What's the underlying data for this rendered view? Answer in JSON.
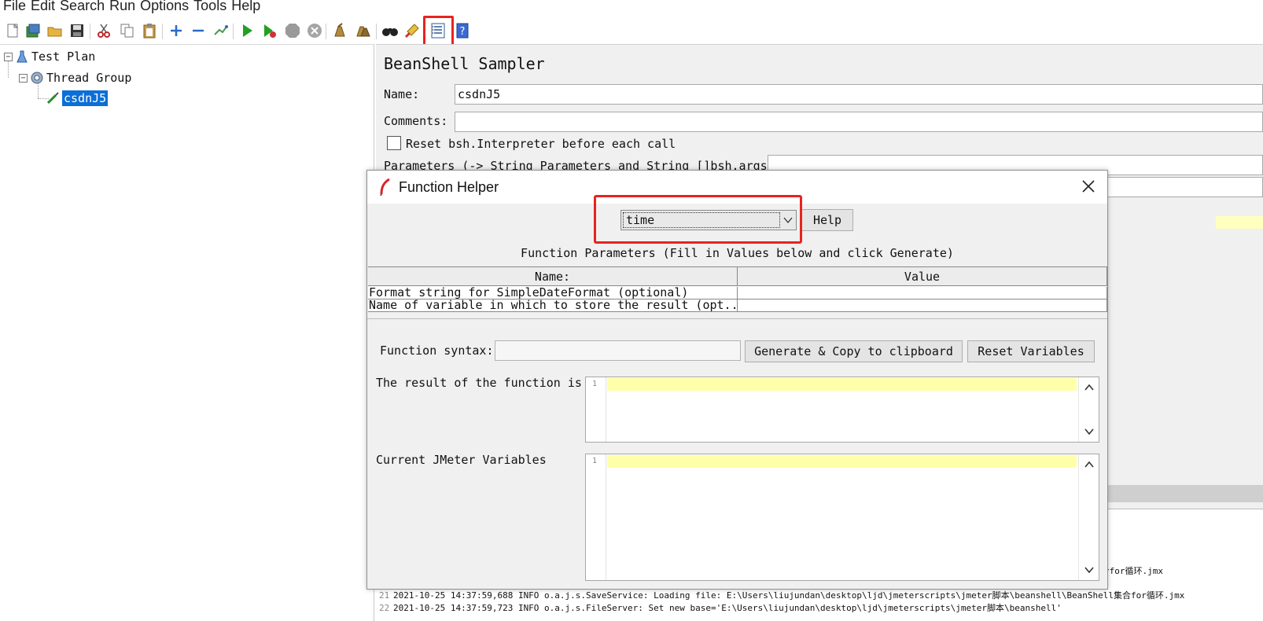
{
  "menu": [
    "File",
    "Edit",
    "Search",
    "Run",
    "Options",
    "Tools",
    "Help"
  ],
  "toolbar": {
    "icons": [
      "new-icon",
      "templates-icon",
      "open-icon",
      "save-icon",
      "cut-icon",
      "copy-icon",
      "paste-icon",
      "expand-icon",
      "collapse-icon",
      "toggle-icon",
      "start-icon",
      "start-no-pauses-icon",
      "stop-icon",
      "shutdown-icon",
      "clear-icon",
      "clear-all-icon",
      "search-icon",
      "reset-search-icon",
      "function-helper-icon",
      "help-icon"
    ],
    "highlight_color": "#e8231e"
  },
  "tree": {
    "items": [
      {
        "label": "Test Plan",
        "icon": "test-plan-icon"
      },
      {
        "label": "Thread Group",
        "icon": "thread-group-icon"
      },
      {
        "label": "csdnJ5",
        "icon": "sampler-icon",
        "selected": true
      }
    ],
    "selected_color": "#0b6fd6"
  },
  "sampler": {
    "title": "BeanShell Sampler",
    "name_label": "Name:",
    "name_value": "csdnJ5",
    "comments_label": "Comments:",
    "comments_value": "",
    "reset_label": "Reset bsh.Interpreter before each call",
    "params_label": "Parameters (-> String Parameters and String []bsh.args)"
  },
  "log": {
    "lines": [
      {
        "num": "",
        "text": "l集合for循环.jmx"
      },
      {
        "num": "21",
        "text": "2021-10-25 14:37:59,688 INFO o.a.j.s.SaveService: Loading file: E:\\Users\\liujundan\\desktop\\ljd\\jmeterscripts\\jmeter脚本\\beanshell\\BeanShell集合for循环.jmx"
      },
      {
        "num": "22",
        "text": "2021-10-25 14:37:59,723 INFO o.a.j.s.FileServer: Set new base='E:\\Users\\liujundan\\desktop\\ljd\\jmeterscripts\\jmeter脚本\\beanshell'"
      }
    ]
  },
  "dialog": {
    "title": "Function Helper",
    "selected_function": "time",
    "help_label": "Help",
    "params_caption": "Function Parameters (Fill in Values below and click Generate)",
    "columns": [
      "Name:",
      "Value"
    ],
    "rows": [
      {
        "name": "Format string for SimpleDateFormat (optional)",
        "value": ""
      },
      {
        "name": "Name of variable in which to store the result (opt...",
        "value": ""
      }
    ],
    "syntax_label": "Function syntax:",
    "syntax_value": "",
    "generate_label": "Generate & Copy to clipboard",
    "reset_label": "Reset Variables",
    "result_label": "The result of the function is",
    "vars_label": "Current JMeter Variables",
    "line_number": "1"
  }
}
